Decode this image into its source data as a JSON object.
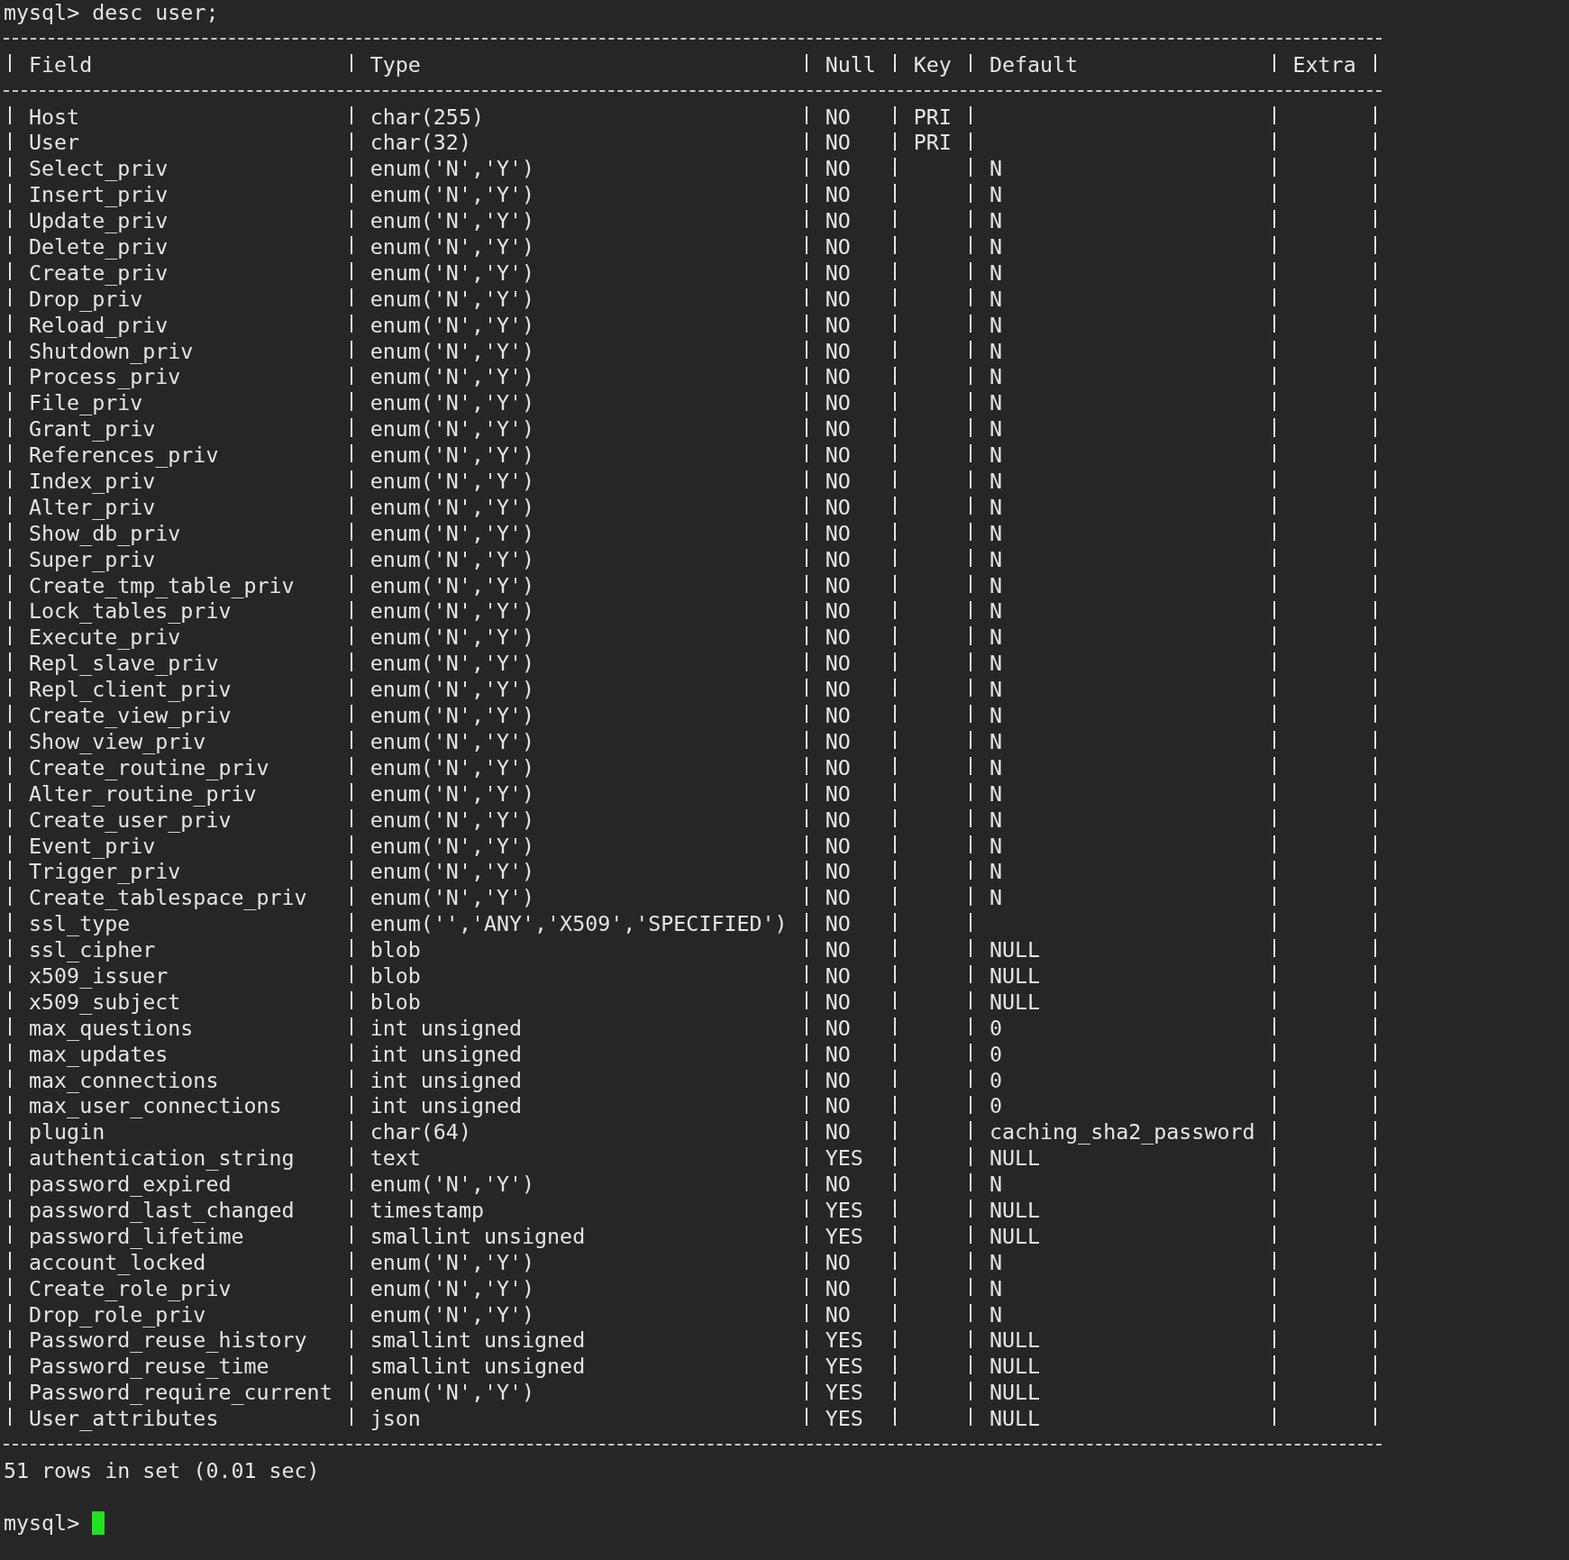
{
  "command": {
    "prompt": "mysql>",
    "text": "desc user;"
  },
  "table": {
    "columns": [
      "Field",
      "Type",
      "Null",
      "Key",
      "Default",
      "Extra"
    ],
    "rows": [
      {
        "field": "Host",
        "type": "char(255)",
        "null": "NO",
        "key": "PRI"
      },
      {
        "field": "User",
        "type": "char(32)",
        "null": "NO",
        "key": "PRI"
      },
      {
        "field": "Select_priv",
        "type": "enum('N','Y')",
        "null": "NO",
        "default": "N"
      },
      {
        "field": "Insert_priv",
        "type": "enum('N','Y')",
        "null": "NO",
        "default": "N"
      },
      {
        "field": "Update_priv",
        "type": "enum('N','Y')",
        "null": "NO",
        "default": "N"
      },
      {
        "field": "Delete_priv",
        "type": "enum('N','Y')",
        "null": "NO",
        "default": "N"
      },
      {
        "field": "Create_priv",
        "type": "enum('N','Y')",
        "null": "NO",
        "default": "N"
      },
      {
        "field": "Drop_priv",
        "type": "enum('N','Y')",
        "null": "NO",
        "default": "N"
      },
      {
        "field": "Reload_priv",
        "type": "enum('N','Y')",
        "null": "NO",
        "default": "N"
      },
      {
        "field": "Shutdown_priv",
        "type": "enum('N','Y')",
        "null": "NO",
        "default": "N"
      },
      {
        "field": "Process_priv",
        "type": "enum('N','Y')",
        "null": "NO",
        "default": "N"
      },
      {
        "field": "File_priv",
        "type": "enum('N','Y')",
        "null": "NO",
        "default": "N"
      },
      {
        "field": "Grant_priv",
        "type": "enum('N','Y')",
        "null": "NO",
        "default": "N"
      },
      {
        "field": "References_priv",
        "type": "enum('N','Y')",
        "null": "NO",
        "default": "N"
      },
      {
        "field": "Index_priv",
        "type": "enum('N','Y')",
        "null": "NO",
        "default": "N"
      },
      {
        "field": "Alter_priv",
        "type": "enum('N','Y')",
        "null": "NO",
        "default": "N"
      },
      {
        "field": "Show_db_priv",
        "type": "enum('N','Y')",
        "null": "NO",
        "default": "N"
      },
      {
        "field": "Super_priv",
        "type": "enum('N','Y')",
        "null": "NO",
        "default": "N"
      },
      {
        "field": "Create_tmp_table_priv",
        "type": "enum('N','Y')",
        "null": "NO",
        "default": "N"
      },
      {
        "field": "Lock_tables_priv",
        "type": "enum('N','Y')",
        "null": "NO",
        "default": "N"
      },
      {
        "field": "Execute_priv",
        "type": "enum('N','Y')",
        "null": "NO",
        "default": "N"
      },
      {
        "field": "Repl_slave_priv",
        "type": "enum('N','Y')",
        "null": "NO",
        "default": "N"
      },
      {
        "field": "Repl_client_priv",
        "type": "enum('N','Y')",
        "null": "NO",
        "default": "N"
      },
      {
        "field": "Create_view_priv",
        "type": "enum('N','Y')",
        "null": "NO",
        "default": "N"
      },
      {
        "field": "Show_view_priv",
        "type": "enum('N','Y')",
        "null": "NO",
        "default": "N"
      },
      {
        "field": "Create_routine_priv",
        "type": "enum('N','Y')",
        "null": "NO",
        "default": "N"
      },
      {
        "field": "Alter_routine_priv",
        "type": "enum('N','Y')",
        "null": "NO",
        "default": "N"
      },
      {
        "field": "Create_user_priv",
        "type": "enum('N','Y')",
        "null": "NO",
        "default": "N"
      },
      {
        "field": "Event_priv",
        "type": "enum('N','Y')",
        "null": "NO",
        "default": "N"
      },
      {
        "field": "Trigger_priv",
        "type": "enum('N','Y')",
        "null": "NO",
        "default": "N"
      },
      {
        "field": "Create_tablespace_priv",
        "type": "enum('N','Y')",
        "null": "NO",
        "default": "N"
      },
      {
        "field": "ssl_type",
        "type": "enum('','ANY','X509','SPECIFIED')",
        "null": "NO"
      },
      {
        "field": "ssl_cipher",
        "type": "blob",
        "null": "NO",
        "default": "NULL"
      },
      {
        "field": "x509_issuer",
        "type": "blob",
        "null": "NO",
        "default": "NULL"
      },
      {
        "field": "x509_subject",
        "type": "blob",
        "null": "NO",
        "default": "NULL"
      },
      {
        "field": "max_questions",
        "type": "int unsigned",
        "null": "NO",
        "default": "0"
      },
      {
        "field": "max_updates",
        "type": "int unsigned",
        "null": "NO",
        "default": "0"
      },
      {
        "field": "max_connections",
        "type": "int unsigned",
        "null": "NO",
        "default": "0"
      },
      {
        "field": "max_user_connections",
        "type": "int unsigned",
        "null": "NO",
        "default": "0"
      },
      {
        "field": "plugin",
        "type": "char(64)",
        "null": "NO",
        "default": "caching_sha2_password"
      },
      {
        "field": "authentication_string",
        "type": "text",
        "null": "YES",
        "default": "NULL"
      },
      {
        "field": "password_expired",
        "type": "enum('N','Y')",
        "null": "NO",
        "default": "N"
      },
      {
        "field": "password_last_changed",
        "type": "timestamp",
        "null": "YES",
        "default": "NULL"
      },
      {
        "field": "password_lifetime",
        "type": "smallint unsigned",
        "null": "YES",
        "default": "NULL"
      },
      {
        "field": "account_locked",
        "type": "enum('N','Y')",
        "null": "NO",
        "default": "N"
      },
      {
        "field": "Create_role_priv",
        "type": "enum('N','Y')",
        "null": "NO",
        "default": "N"
      },
      {
        "field": "Drop_role_priv",
        "type": "enum('N','Y')",
        "null": "NO",
        "default": "N"
      },
      {
        "field": "Password_reuse_history",
        "type": "smallint unsigned",
        "null": "YES",
        "default": "NULL"
      },
      {
        "field": "Password_reuse_time",
        "type": "smallint unsigned",
        "null": "YES",
        "default": "NULL"
      },
      {
        "field": "Password_require_current",
        "type": "enum('N','Y')",
        "null": "YES",
        "default": "NULL"
      },
      {
        "field": "User_attributes",
        "type": "json",
        "null": "YES",
        "default": "NULL"
      }
    ]
  },
  "summary": "51 rows in set (0.01 sec)",
  "prompt": "mysql>"
}
